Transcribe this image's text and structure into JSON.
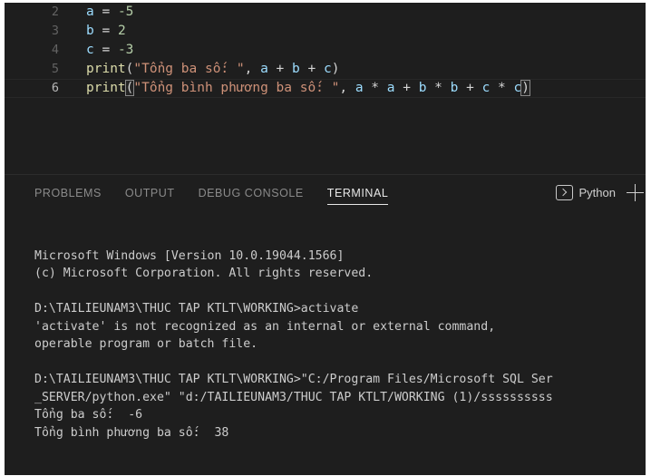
{
  "editor": {
    "name": "code-editor",
    "language": "python",
    "lines": [
      {
        "number": "2",
        "tokens": [
          {
            "t": "a",
            "c": "var"
          },
          {
            "t": " ",
            "c": "op"
          },
          {
            "t": "=",
            "c": "op"
          },
          {
            "t": " ",
            "c": "op"
          },
          {
            "t": "-5",
            "c": "num"
          }
        ],
        "active": false
      },
      {
        "number": "3",
        "tokens": [
          {
            "t": "b",
            "c": "var"
          },
          {
            "t": " ",
            "c": "op"
          },
          {
            "t": "=",
            "c": "op"
          },
          {
            "t": " ",
            "c": "op"
          },
          {
            "t": "2",
            "c": "num"
          }
        ],
        "active": false
      },
      {
        "number": "4",
        "tokens": [
          {
            "t": "c",
            "c": "var"
          },
          {
            "t": " ",
            "c": "op"
          },
          {
            "t": "=",
            "c": "op"
          },
          {
            "t": " ",
            "c": "op"
          },
          {
            "t": "-3",
            "c": "num"
          }
        ],
        "active": false
      },
      {
        "number": "5",
        "tokens": [
          {
            "t": "print",
            "c": "fn"
          },
          {
            "t": "(",
            "c": "paren"
          },
          {
            "t": "\"Tổng ba số: \"",
            "c": "str"
          },
          {
            "t": ",",
            "c": "punct"
          },
          {
            "t": " ",
            "c": "op"
          },
          {
            "t": "a",
            "c": "var"
          },
          {
            "t": " + ",
            "c": "op"
          },
          {
            "t": "b",
            "c": "var"
          },
          {
            "t": " + ",
            "c": "op"
          },
          {
            "t": "c",
            "c": "var"
          },
          {
            "t": ")",
            "c": "paren"
          }
        ],
        "active": false
      },
      {
        "number": "6",
        "tokens": [
          {
            "t": "print",
            "c": "fn"
          },
          {
            "t": "(",
            "c": "paren",
            "bracket_match": true
          },
          {
            "t": "\"Tổng bình phương ba số: \"",
            "c": "str"
          },
          {
            "t": ",",
            "c": "punct"
          },
          {
            "t": " ",
            "c": "op"
          },
          {
            "t": "a",
            "c": "var"
          },
          {
            "t": " * ",
            "c": "op"
          },
          {
            "t": "a",
            "c": "var"
          },
          {
            "t": " + ",
            "c": "op"
          },
          {
            "t": "b",
            "c": "var"
          },
          {
            "t": " * ",
            "c": "op"
          },
          {
            "t": "b",
            "c": "var"
          },
          {
            "t": " + ",
            "c": "op"
          },
          {
            "t": "c",
            "c": "var"
          },
          {
            "t": " * ",
            "c": "op"
          },
          {
            "t": "c",
            "c": "var"
          },
          {
            "t": ")",
            "c": "paren",
            "bracket_match": true
          }
        ],
        "active": true,
        "caret_at_end": true
      }
    ]
  },
  "panel": {
    "tabs": [
      {
        "label": "PROBLEMS",
        "active": false,
        "name": "tab-problems"
      },
      {
        "label": "OUTPUT",
        "active": false,
        "name": "tab-output"
      },
      {
        "label": "DEBUG CONSOLE",
        "active": false,
        "name": "tab-debug-console"
      },
      {
        "label": "TERMINAL",
        "active": true,
        "name": "tab-terminal"
      }
    ],
    "terminal_kind_label": "Python",
    "terminal_icon": "terminal-chevron-icon",
    "new_terminal_icon": "plus-icon",
    "terminal_lines": [
      "",
      "Microsoft Windows [Version 10.0.19044.1566]",
      "(c) Microsoft Corporation. All rights reserved.",
      "",
      "D:\\TAILIEUNAM3\\THUC TAP KTLT\\WORKING>activate",
      "'activate' is not recognized as an internal or external command,",
      "operable program or batch file.",
      "",
      "D:\\TAILIEUNAM3\\THUC TAP KTLT\\WORKING>\"C:/Program Files/Microsoft SQL Ser",
      "_SERVER/python.exe\" \"d:/TAILIEUNAM3/THUC TAP KTLT/WORKING (1)/ssssssssss",
      "Tổng ba số:  -6",
      "Tổng bình phương ba số:  38"
    ]
  },
  "colors": {
    "editor_background": "#1e1e1e",
    "panel_background": "#1e1e1e",
    "variable": "#9cdcfe",
    "number": "#b5cea8",
    "function": "#dcdcaa",
    "string": "#ce9178",
    "operator": "#d4d4d4",
    "line_number": "#636363",
    "line_number_active": "#b9b9b9",
    "terminal_text": "#cccccc",
    "tab_inactive": "#8a8a8a",
    "tab_active": "#e7e7e7"
  }
}
